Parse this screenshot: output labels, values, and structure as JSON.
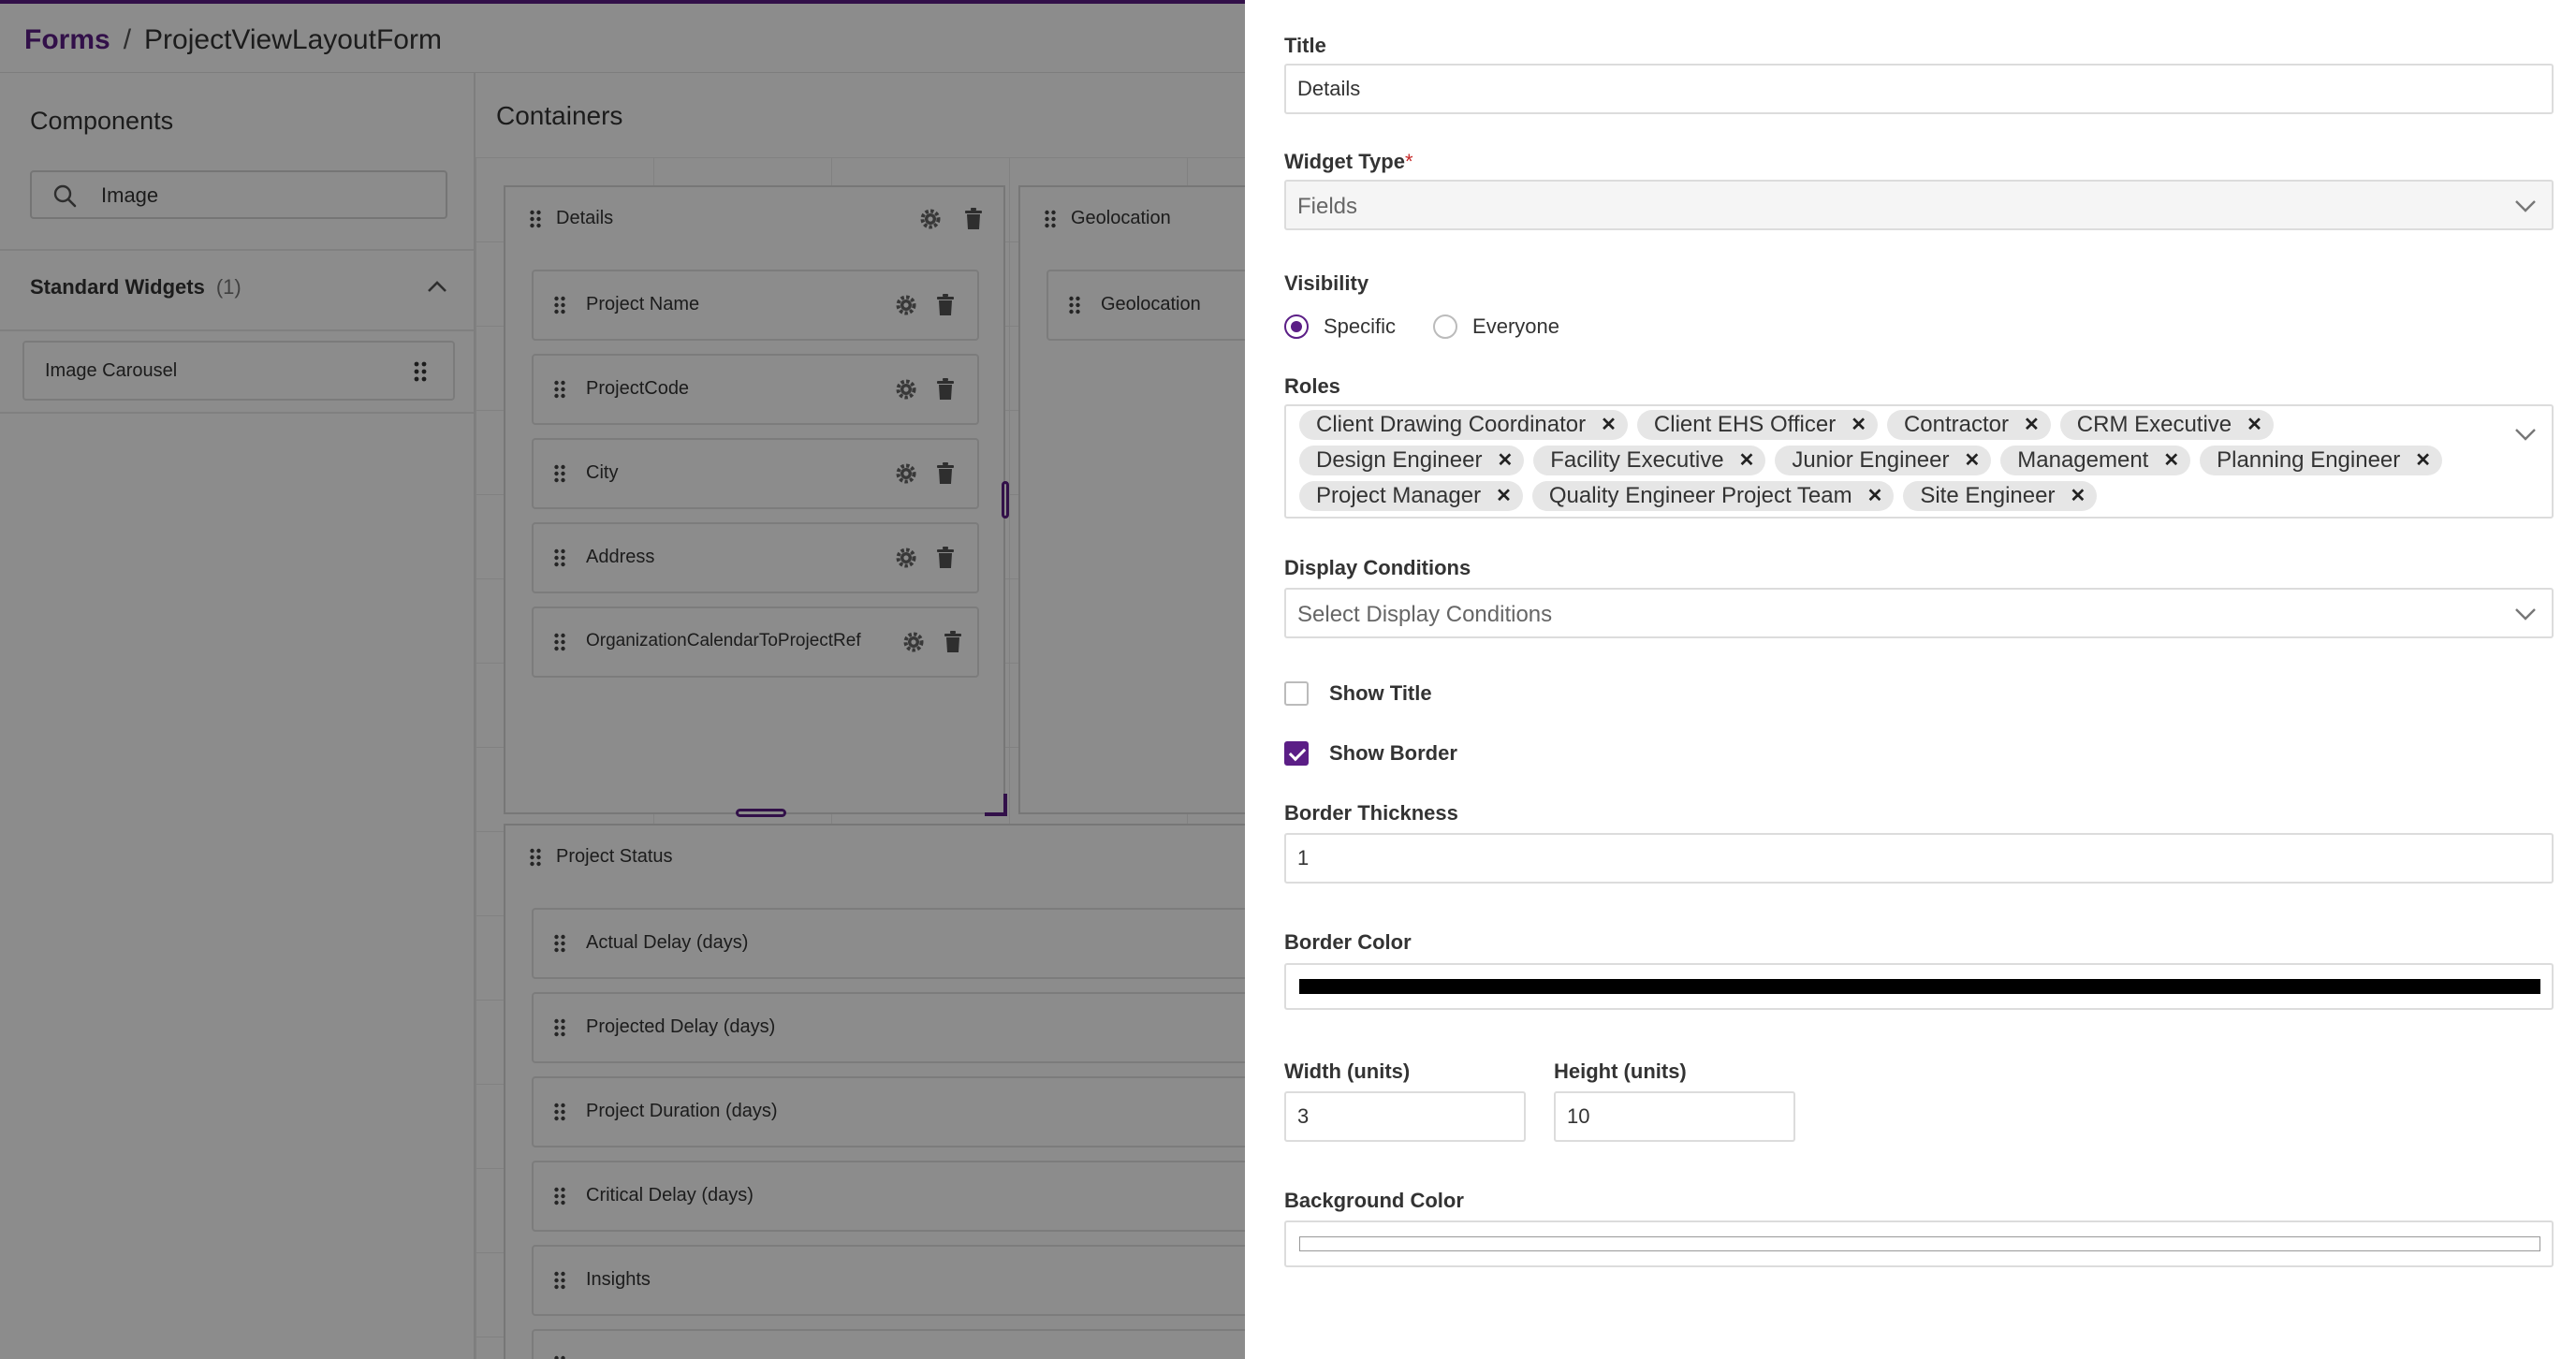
{
  "breadcrumb": {
    "root": "Forms",
    "separator": "/",
    "current": "ProjectViewLayoutForm"
  },
  "components": {
    "title": "Components",
    "search_value": "Image",
    "section_label": "Standard Widgets",
    "section_count": "(1)",
    "items": [
      {
        "label": "Image Carousel"
      }
    ]
  },
  "canvas": {
    "title": "Containers",
    "containers": [
      {
        "title": "Details",
        "fields": [
          "Project Name",
          "ProjectCode",
          "City",
          "Address",
          "OrganizationCalendarToProjectRef"
        ]
      },
      {
        "title": "Geolocation",
        "fields": [
          "Geolocation"
        ]
      },
      {
        "title": "Project Status",
        "fields": [
          "Actual Delay (days)",
          "Projected Delay (days)",
          "Project Duration (days)",
          "Critical Delay (days)",
          "Insights"
        ]
      }
    ]
  },
  "panel": {
    "title_label": "Title",
    "title_value": "Details",
    "widget_type_label": "Widget Type",
    "required_mark": "*",
    "widget_type_value": "Fields",
    "visibility_label": "Visibility",
    "visibility_options": [
      "Specific",
      "Everyone"
    ],
    "visibility_selected": "Specific",
    "roles_label": "Roles",
    "roles": [
      "Client Drawing Coordinator",
      "Client EHS Officer",
      "Contractor",
      "CRM Executive",
      "Design Engineer",
      "Facility Executive",
      "Junior Engineer",
      "Management",
      "Planning Engineer",
      "Project Manager",
      "Quality Engineer Project Team",
      "Site Engineer"
    ],
    "chip_remove_glyph": "✕",
    "display_conditions_label": "Display Conditions",
    "display_conditions_placeholder": "Select Display Conditions",
    "show_title_label": "Show Title",
    "show_title_checked": false,
    "show_border_label": "Show Border",
    "show_border_checked": true,
    "border_thickness_label": "Border Thickness",
    "border_thickness_value": "1",
    "border_color_label": "Border Color",
    "border_color_value": "#000000",
    "width_label": "Width (units)",
    "width_value": "3",
    "height_label": "Height (units)",
    "height_value": "10",
    "background_color_label": "Background Color",
    "background_color_value": "#ffffff"
  },
  "colors": {
    "accent": "#5b1e86",
    "required": "#c62828"
  }
}
